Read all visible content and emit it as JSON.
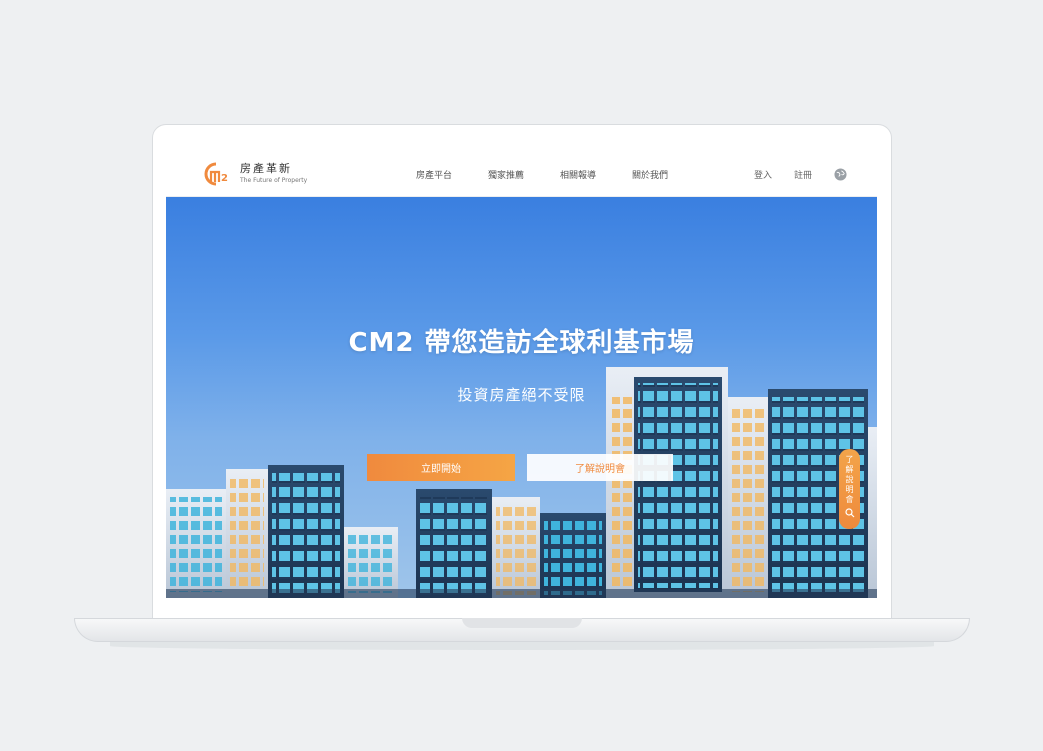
{
  "brand": {
    "name": "房產革新",
    "tagline": "The Future of Property",
    "logo_color": "#f08a3e"
  },
  "nav": {
    "links": [
      "房產平台",
      "獨家推薦",
      "相關報導",
      "關於我們"
    ],
    "login": "登入",
    "register": "註冊",
    "globe_icon": "globe-icon"
  },
  "hero": {
    "title": "CM2 帶您造訪全球利基市場",
    "subtitle": "投資房產絕不受限",
    "primary_button": "立即開始",
    "secondary_button": "了解說明會",
    "side_tab": "了解說明會",
    "side_tab_icon": "search-icon"
  },
  "colors": {
    "accent": "#f08a3e",
    "sky_top": "#3a7fe0",
    "sky_bottom": "#9fc5ea"
  }
}
